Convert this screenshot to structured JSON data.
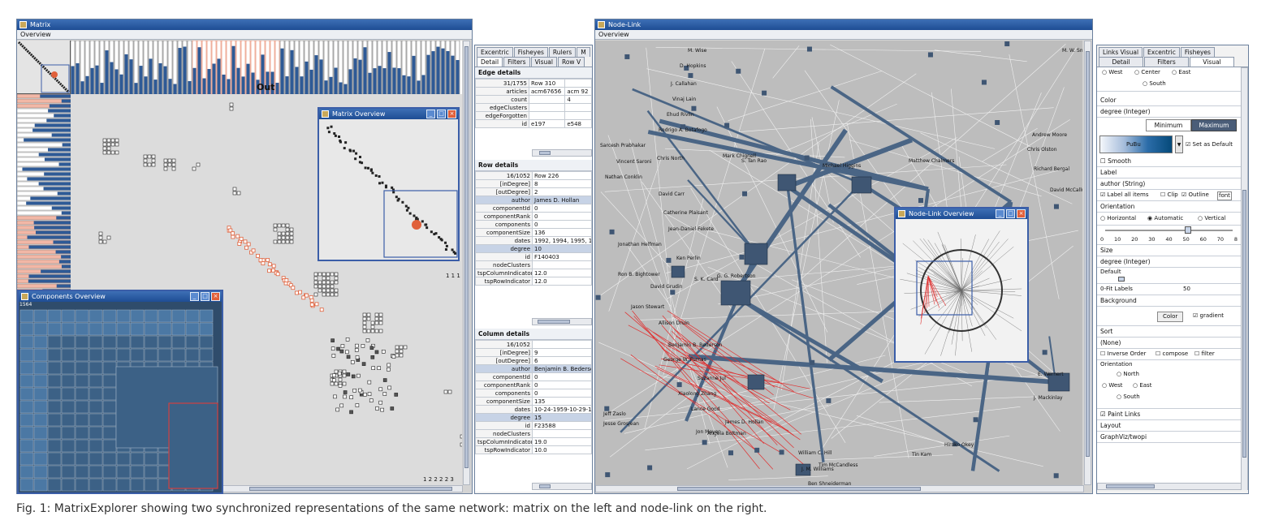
{
  "matrix_window": {
    "title": "Matrix",
    "menu": "Overview",
    "out_label": "Out",
    "overview_popup_title": "Matrix Overview",
    "cluster_count_label": "1 1 1",
    "row_labels_bottom": "1 2 2 2 2 3"
  },
  "components_window": {
    "title": "Components Overview",
    "header_count": "1564"
  },
  "details_panel": {
    "tabs_row1": [
      "Excentric",
      "Fisheyes",
      "Rulers",
      "M"
    ],
    "tabs_row2": [
      "Detail",
      "Filters",
      "Visual",
      "Row V"
    ],
    "edge": {
      "header": "Edge details",
      "rows": [
        [
          "31/1755",
          "Row 310",
          ""
        ],
        [
          "articles",
          "acm67656",
          "acm 92"
        ],
        [
          "count",
          "",
          "4"
        ],
        [
          "edgeClusters",
          "",
          ""
        ],
        [
          "edgeForgotten",
          "",
          ""
        ],
        [
          "id",
          "e197",
          "e548"
        ]
      ]
    },
    "row": {
      "header": "Row details",
      "rows": [
        [
          "16/1052",
          "Row 226"
        ],
        [
          "[inDegree]",
          "8"
        ],
        [
          "[outDegree]",
          "2"
        ],
        [
          "author",
          "James D. Hollan"
        ],
        [
          "componentId",
          "0"
        ],
        [
          "componentRank",
          "0"
        ],
        [
          "components",
          "0"
        ],
        [
          "componentSize",
          "136"
        ],
        [
          "dates",
          "1992, 1994, 1995, 1"
        ],
        [
          "degree",
          "10"
        ],
        [
          "id",
          "F140403"
        ],
        [
          "nodeClusters",
          ""
        ],
        [
          "tspColumnIndicator",
          "12.0"
        ],
        [
          "tspRowIndicator",
          "12.0"
        ]
      ]
    },
    "column": {
      "header": "Column details",
      "rows": [
        [
          "16/1052",
          ""
        ],
        [
          "[inDegree]",
          "9"
        ],
        [
          "[outDegree]",
          "6"
        ],
        [
          "author",
          "Benjamin B. Bederson"
        ],
        [
          "componentId",
          "0"
        ],
        [
          "componentRank",
          "0"
        ],
        [
          "components",
          "0"
        ],
        [
          "componentSize",
          "135"
        ],
        [
          "dates",
          "10-24-1959-10-29-1"
        ],
        [
          "degree",
          "15"
        ],
        [
          "id",
          "F23588"
        ],
        [
          "nodeClusters",
          ""
        ],
        [
          "tspColumnIndicator",
          "19.0"
        ],
        [
          "tspRowIndicator",
          "10.0"
        ]
      ]
    }
  },
  "nodelink_window": {
    "title": "Node-Link",
    "menu": "Overview",
    "overview_popup_title": "Node-Link Overview",
    "node_labels": [
      "M. Wise",
      "D. Hopkins",
      "J. Callahan",
      "Vinaj Lain",
      "Ehud Rivlin",
      "Rodrigo A. Botafogo",
      "Sarcesh Prabhakar",
      "Vincent Saroni",
      "Chris North",
      "Nathan Conklin",
      "David Carr",
      "Catherine Plaisant",
      "Jean-Daniel Fekete",
      "Jonathan Helfman",
      "Ken Perlin",
      "Ron B. Bightower",
      "David Grudin",
      "Jason Stewart",
      "Allison Druin",
      "Benjamin B. Bederson",
      "George W. Furnas",
      "Suzanne Jul",
      "Xiaolong Zhang",
      "Jeff Zaslo",
      "Jesse Grosjean",
      "Lance Good",
      "Jon Meyer",
      "James D. Hollan",
      "Angela Boltman",
      "William C. Hill",
      "Tim McCandless",
      "Ben Shneiderman",
      "S. K. Card",
      "G. G. Robertson",
      "Mark Chignell",
      "S. Tan Rao",
      "Michael Higgins",
      "Matthew Chalmers",
      "Andrew Moore",
      "Chris Olston",
      "J. Mackinlay",
      "E. Wernert",
      "J. M. Williams",
      "Richard Bergal",
      "David McCallum",
      "Tin Kam",
      "Hiroko Okey",
      "M. W. Smith"
    ]
  },
  "visual_panel": {
    "tabs_row1": [
      "Links Visual",
      "Excentric",
      "Fisheyes"
    ],
    "tabs_row2": [
      "Detail",
      "Filters",
      "Visual"
    ],
    "position_options": [
      "West",
      "Center",
      "East",
      "South"
    ],
    "color_section": "Color",
    "color_attr": "degree (Integer)",
    "min_label": "Minimum",
    "max_label": "Maximum",
    "palette": "PuBu",
    "set_default": "Set as Default",
    "smooth": "Smooth",
    "label_section": "Label",
    "label_attr": "author (String)",
    "label_all": "Label all items",
    "clip": "Clip",
    "outline": "Outline",
    "font_btn": "font",
    "orientation_section": "Orientation",
    "orientation_options": [
      "Horizontal",
      "Automatic",
      "Vertical"
    ],
    "slider_ticks": [
      "0",
      "10",
      "20",
      "30",
      "40",
      "50",
      "60",
      "70",
      "8"
    ],
    "size_section": "Size",
    "size_attr": "degree (Integer)",
    "default_label": "Default",
    "fit_labels": "0-Fit Labels",
    "fit_value": "50",
    "background_section": "Background",
    "color_btn": "Color",
    "gradient": "gradient",
    "sort_section": "Sort",
    "sort_value": "(None)",
    "inverse_order": "Inverse Order",
    "compose": "compose",
    "filter": "filter",
    "orientation2_section": "Orientation",
    "orientation2_options": [
      "North",
      "West",
      "East",
      "South"
    ],
    "paint_links": "Paint Links",
    "layout_section": "Layout",
    "layout_value": "GraphViz/twopi"
  },
  "caption": "Fig. 1: MatrixExplorer showing two synchronized representations of the same network: matrix on the left and node-link on the right."
}
